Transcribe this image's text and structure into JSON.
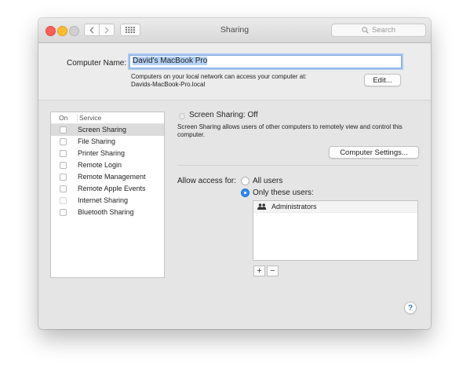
{
  "window": {
    "title": "Sharing"
  },
  "search": {
    "placeholder": "Search"
  },
  "computer_name": {
    "label": "Computer Name:",
    "value": "David's MacBook Pro",
    "info_line1": "Computers on your local network can access your computer at:",
    "info_line2": "Davids-MacBook-Pro.local",
    "edit_label": "Edit..."
  },
  "service_list": {
    "header_on": "On",
    "header_service": "Service",
    "items": [
      {
        "label": "Screen Sharing",
        "enabled": false
      },
      {
        "label": "File Sharing",
        "enabled": false
      },
      {
        "label": "Printer Sharing",
        "enabled": false
      },
      {
        "label": "Remote Login",
        "enabled": false
      },
      {
        "label": "Remote Management",
        "enabled": false
      },
      {
        "label": "Remote Apple Events",
        "enabled": false
      },
      {
        "label": "Internet Sharing",
        "enabled": false
      },
      {
        "label": "Bluetooth Sharing",
        "enabled": false
      }
    ]
  },
  "detail": {
    "status": "Screen Sharing: Off",
    "description": "Screen Sharing allows users of other computers to remotely view and control this computer.",
    "computer_settings_label": "Computer Settings...",
    "allow_access_label": "Allow access for:",
    "option_all": "All users",
    "option_only": "Only these users:",
    "users": [
      "Administrators"
    ]
  },
  "controls": {
    "add": "+",
    "remove": "−",
    "help": "?"
  },
  "colors": {
    "accent": "#2f8bf3",
    "close": "#fc5f57",
    "minimize": "#fdbc2e",
    "zoom": "#d0d0d0"
  }
}
